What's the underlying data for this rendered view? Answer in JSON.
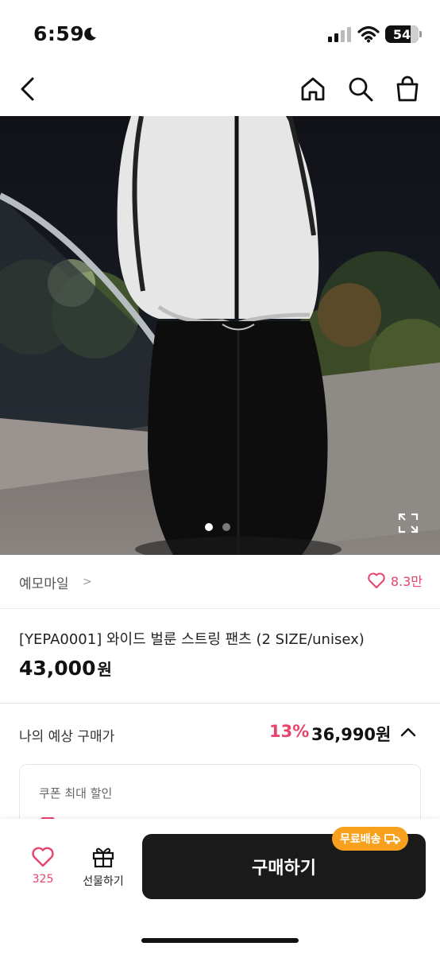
{
  "status": {
    "time": "6:59",
    "battery": "54"
  },
  "store": {
    "name": "예모마일",
    "chevron": ">",
    "likes": "8.3만"
  },
  "product": {
    "title": "[YEPA0001] 와이드 벌룬 스트링 팬츠 (2 SIZE/unisex)",
    "price": "43,000",
    "currency": "원"
  },
  "expected": {
    "label": "나의 예상 구매가",
    "discount": "13%",
    "price": "36,990원"
  },
  "coupon": {
    "title": "쿠폰 최대 할인"
  },
  "bottom": {
    "wish_count": "325",
    "gift_label": "선물하기",
    "buy_label": "구매하기",
    "shipping_badge": "무료배송"
  },
  "carousel": {
    "total": 2,
    "active": 1
  },
  "colors": {
    "accent": "#e8436d",
    "badge": "#f7a11f",
    "buy_button": "#1a1a1a"
  }
}
